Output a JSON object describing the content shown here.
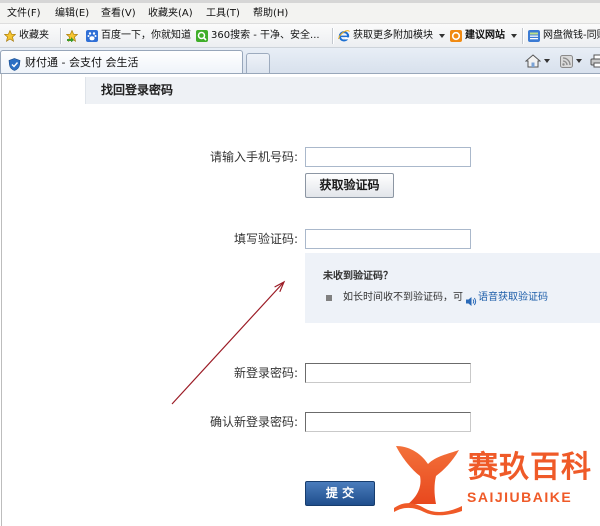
{
  "browser": {
    "menu": [
      "文件(F)",
      "编辑(E)",
      "查看(V)",
      "收藏夹(A)",
      "工具(T)",
      "帮助(H)"
    ],
    "favorites_bar": {
      "favorites_label": "收藏夹",
      "links": [
        {
          "label": "百度一下，你就知道",
          "icon": "baidu-icon"
        },
        {
          "label": "360搜索 - 干净、安全...",
          "icon": "360-search-icon"
        },
        {
          "label": "获取更多附加模块",
          "icon": "ie-icon",
          "has_dropdown": true
        },
        {
          "label": "建议网站",
          "icon": "suggested-sites-icon",
          "has_dropdown": true
        },
        {
          "label": "网盘微钱-同账",
          "icon": "web-slice-icon"
        }
      ]
    },
    "tabs": [
      {
        "title": "财付通 - 会支付 会生活",
        "icon": "tenpay-icon",
        "active": true
      }
    ],
    "command_icons": [
      "home-icon",
      "rss-feed-icon",
      "print-icon"
    ]
  },
  "page": {
    "title": "找回登录密码",
    "form": {
      "phone_label": "请输入手机号码:",
      "phone_value": "",
      "get_code_button": "获取验证码",
      "code_label": "填写验证码:",
      "code_value": "",
      "notice": {
        "heading": "未收到验证码？",
        "text": "如长时间收不到验证码，可",
        "voice_link": "语音获取验证码"
      },
      "new_password_label": "新登录密码:",
      "new_password_value": "",
      "confirm_password_label": "确认新登录密码:",
      "confirm_password_value": "",
      "submit_button": "提 交"
    }
  },
  "annotation": {
    "type": "arrow",
    "color": "#9b1b25"
  },
  "watermark": {
    "brand_cn": "赛玖百科",
    "brand_en": "SAIJIUBAIKE",
    "icon": "whale-tail-logo",
    "color": "#ef5a28"
  },
  "colors": {
    "submit_button": "#1f4e8c",
    "link": "#1b5ca8",
    "notice_background": "#eef2f8"
  }
}
